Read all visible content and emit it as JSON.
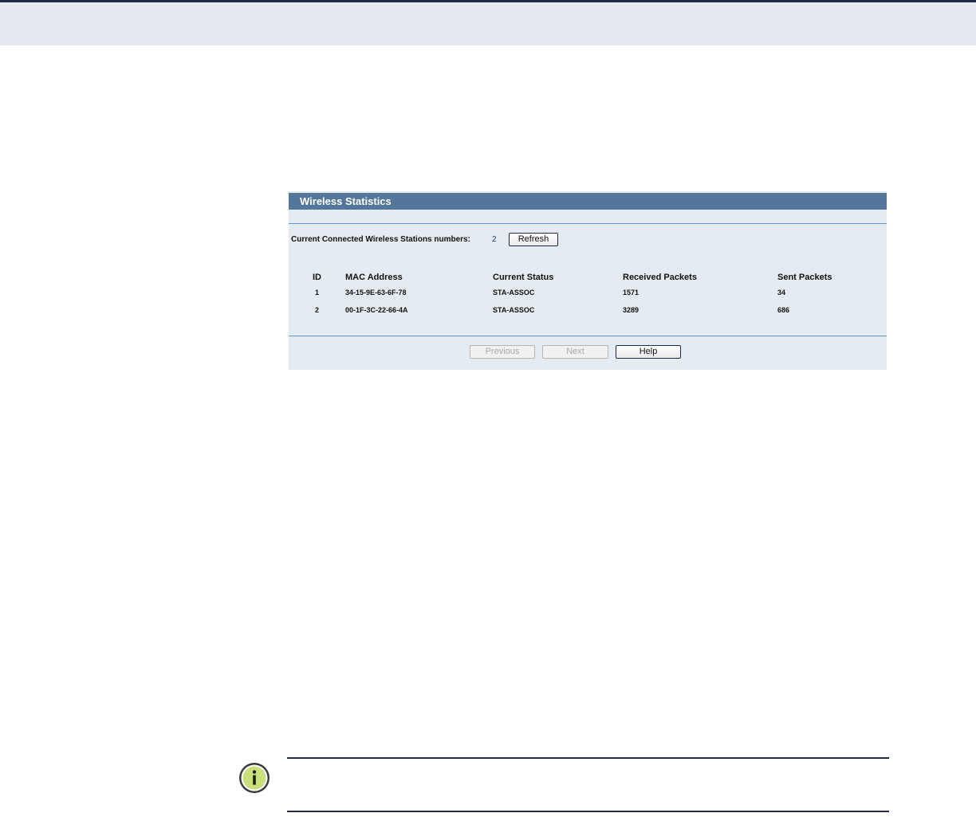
{
  "panel": {
    "title": "Wireless Statistics",
    "stations_label": "Current Connected Wireless Stations numbers:",
    "stations_count": "2",
    "refresh_label": "Refresh"
  },
  "table": {
    "headers": [
      "ID",
      "MAC Address",
      "Current Status",
      "Received Packets",
      "Sent Packets"
    ],
    "rows": [
      [
        "1",
        "34-15-9E-63-6F-78",
        "STA-ASSOC",
        "1571",
        "34"
      ],
      [
        "2",
        "00-1F-3C-22-66-4A",
        "STA-ASSOC",
        "3289",
        "686"
      ]
    ]
  },
  "buttons": {
    "previous": "Previous",
    "next": "Next",
    "help": "Help"
  },
  "icons": {
    "note": "info-note-icon"
  },
  "colors": {
    "header_band": "#e6e9f0",
    "title_bar": "#53779b",
    "panel_bg": "#e4ebf1",
    "rule": "#5f9acb",
    "note_icon": "#c8df7a"
  }
}
